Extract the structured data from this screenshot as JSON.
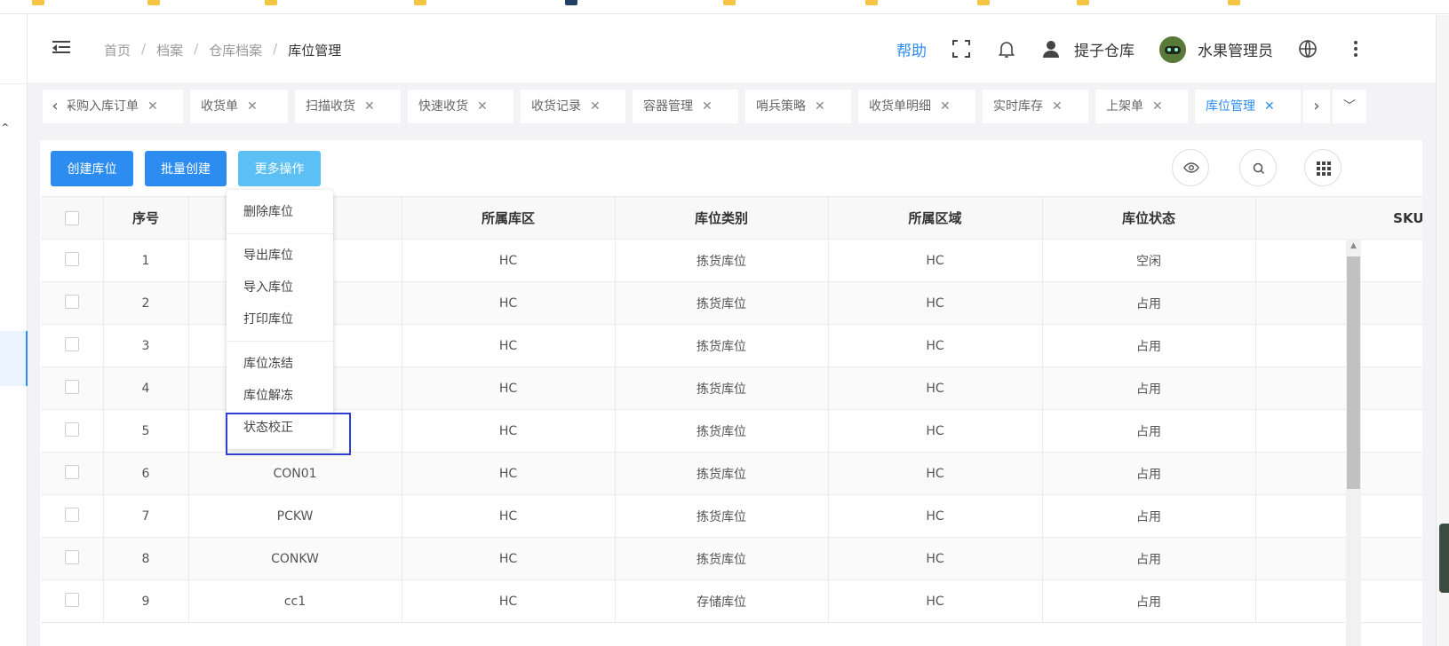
{
  "header": {
    "breadcrumb": [
      "首页",
      "档案",
      "仓库档案",
      "库位管理"
    ],
    "help": "帮助",
    "warehouse": "提子仓库",
    "user": "水果管理员",
    "icons": [
      "fullscreen-icon",
      "bell-icon",
      "user-icon",
      "avatar",
      "globe-icon",
      "more-vertical-icon"
    ]
  },
  "tabs": [
    {
      "label": "采购入库订单"
    },
    {
      "label": "收货单"
    },
    {
      "label": "扫描收货"
    },
    {
      "label": "快速收货"
    },
    {
      "label": "收货记录"
    },
    {
      "label": "容器管理"
    },
    {
      "label": "哨兵策略"
    },
    {
      "label": "收货单明细"
    },
    {
      "label": "实时库存"
    },
    {
      "label": "上架单"
    },
    {
      "label": "库位管理"
    }
  ],
  "toolbar": {
    "create": "创建库位",
    "batch_create": "批量创建",
    "more": "更多操作"
  },
  "dropdown": {
    "items": [
      "删除库位",
      "导出库位",
      "导入库位",
      "打印库位",
      "库位冻结",
      "库位解冻",
      "状态校正"
    ]
  },
  "table": {
    "headers": [
      "序号",
      "",
      "所属库区",
      "库位类别",
      "所属区域",
      "库位状态",
      "SKU"
    ],
    "rows": [
      {
        "no": "1",
        "code": "",
        "zone": "HC",
        "type": "拣货库位",
        "area": "HC",
        "status": "空闲"
      },
      {
        "no": "2",
        "code": "",
        "zone": "HC",
        "type": "拣货库位",
        "area": "HC",
        "status": "占用"
      },
      {
        "no": "3",
        "code": "",
        "zone": "HC",
        "type": "拣货库位",
        "area": "HC",
        "status": "占用"
      },
      {
        "no": "4",
        "code": "",
        "zone": "HC",
        "type": "拣货库位",
        "area": "HC",
        "status": "占用"
      },
      {
        "no": "5",
        "code": "",
        "zone": "HC",
        "type": "拣货库位",
        "area": "HC",
        "status": "占用"
      },
      {
        "no": "6",
        "code": "CON01",
        "zone": "HC",
        "type": "拣货库位",
        "area": "HC",
        "status": "占用"
      },
      {
        "no": "7",
        "code": "PCKW",
        "zone": "HC",
        "type": "拣货库位",
        "area": "HC",
        "status": "占用"
      },
      {
        "no": "8",
        "code": "CONKW",
        "zone": "HC",
        "type": "拣货库位",
        "area": "HC",
        "status": "占用"
      },
      {
        "no": "9",
        "code": "cc1",
        "zone": "HC",
        "type": "存储库位",
        "area": "HC",
        "status": "占用"
      }
    ]
  }
}
